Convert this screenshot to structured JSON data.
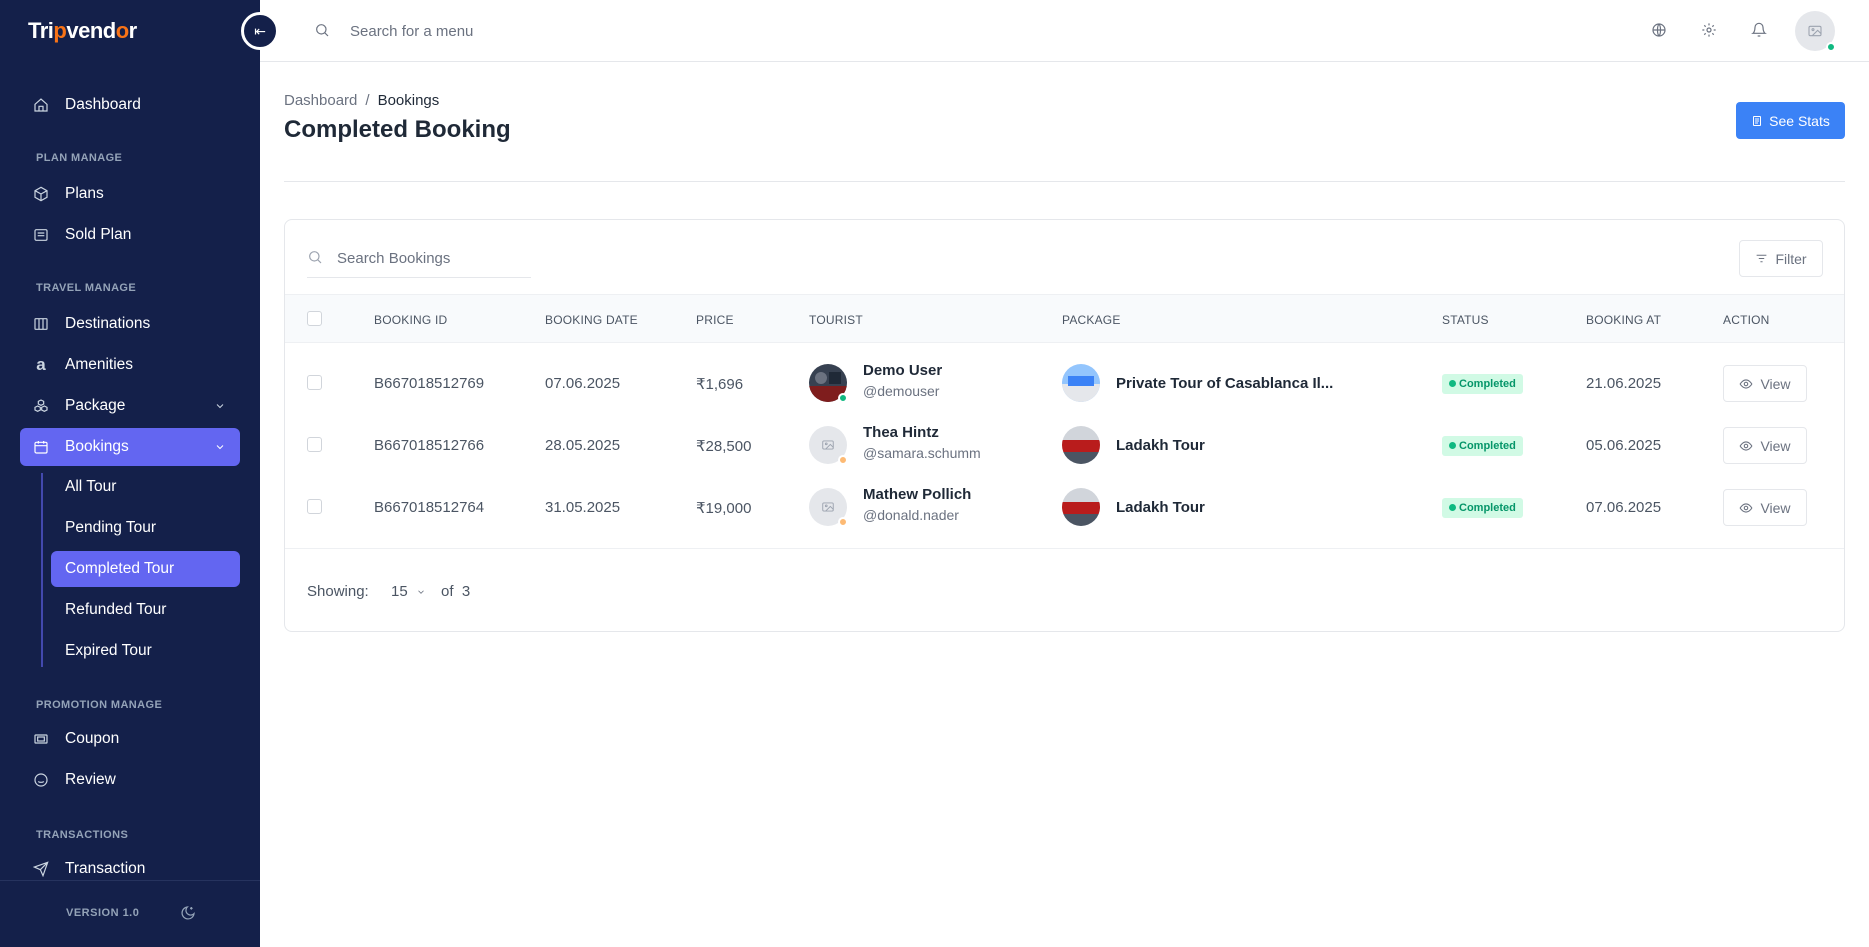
{
  "app": {
    "logo_text_start": "Tri",
    "logo_text_dot": "p",
    "logo_text_end": "vend",
    "logo_text_o": "o",
    "logo_text_r": "r"
  },
  "topbar": {
    "search_placeholder": "Search for a menu"
  },
  "sidebar": {
    "dashboard": "Dashboard",
    "sections": {
      "plan": "PLAN MANAGE",
      "travel": "TRAVEL MANAGE",
      "promotion": "PROMOTION MANAGE",
      "transactions": "TRANSACTIONS"
    },
    "plans": "Plans",
    "sold_plan": "Sold Plan",
    "destinations": "Destinations",
    "amenities": "Amenities",
    "package": "Package",
    "bookings": "Bookings",
    "sub": {
      "all": "All Tour",
      "pending": "Pending Tour",
      "completed": "Completed Tour",
      "refunded": "Refunded Tour",
      "expired": "Expired Tour"
    },
    "coupon": "Coupon",
    "review": "Review",
    "transaction": "Transaction",
    "version": "VERSION 1.0"
  },
  "page": {
    "breadcrumb_root": "Dashboard",
    "breadcrumb_sep": "/",
    "breadcrumb_current": "Bookings",
    "title": "Completed Booking",
    "see_stats": "See Stats"
  },
  "table": {
    "search_placeholder": "Search Bookings",
    "filter_label": "Filter",
    "headers": {
      "booking_id": "BOOKING ID",
      "booking_date": "BOOKING DATE",
      "price": "PRICE",
      "tourist": "TOURIST",
      "package": "PACKAGE",
      "status": "STATUS",
      "booking_at": "BOOKING AT",
      "action": "ACTION"
    },
    "rows": [
      {
        "id": "B667018512769",
        "date": "07.06.2025",
        "price": "₹1,696",
        "name": "Demo User",
        "handle": "@demouser",
        "package": "Private Tour of Casablanca Il...",
        "status": "Completed",
        "booking_at": "21.06.2025",
        "action": "View"
      },
      {
        "id": "B667018512766",
        "date": "28.05.2025",
        "price": "₹28,500",
        "name": "Thea Hintz",
        "handle": "@samara.schumm",
        "package": "Ladakh Tour",
        "status": "Completed",
        "booking_at": "05.06.2025",
        "action": "View"
      },
      {
        "id": "B667018512764",
        "date": "31.05.2025",
        "price": "₹19,000",
        "name": "Mathew Pollich",
        "handle": "@donald.nader",
        "package": "Ladakh Tour",
        "status": "Completed",
        "booking_at": "07.06.2025",
        "action": "View"
      }
    ],
    "footer": {
      "showing_label": "Showing:",
      "per_page": "15",
      "of_label": "of",
      "total": "3"
    }
  },
  "colors": {
    "sidebar_bg": "#14204a",
    "accent": "#6366f1",
    "primary_button": "#3b82f6",
    "success": "#10b981",
    "away": "#fdba74"
  }
}
